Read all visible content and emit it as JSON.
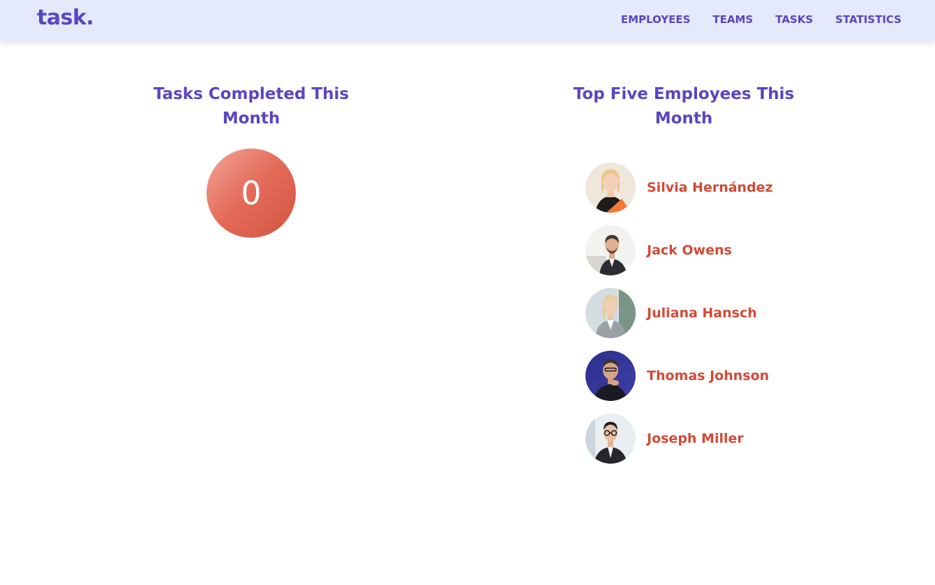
{
  "nav": {
    "logo": "task.",
    "links": [
      "EMPLOYEES",
      "TEAMS",
      "TASKS",
      "STATISTICS"
    ]
  },
  "tasks_section": {
    "title": "Tasks Completed This Month",
    "count": "0"
  },
  "employees_section": {
    "title": "Top Five Employees This Month",
    "employees": [
      {
        "name": "Silvia Hernández",
        "avatar": "woman-portrait-orange-folder"
      },
      {
        "name": "Jack Owens",
        "avatar": "man-portrait-office"
      },
      {
        "name": "Juliana Hansch",
        "avatar": "woman-portrait-grey-suit"
      },
      {
        "name": "Thomas Johnson",
        "avatar": "man-portrait-blue-background"
      },
      {
        "name": "Joseph Miller",
        "avatar": "man-portrait-glasses"
      }
    ]
  },
  "colors": {
    "brand": "#5b45c0",
    "accent": "#d24a36",
    "nav_background": "#e4e9fb"
  }
}
